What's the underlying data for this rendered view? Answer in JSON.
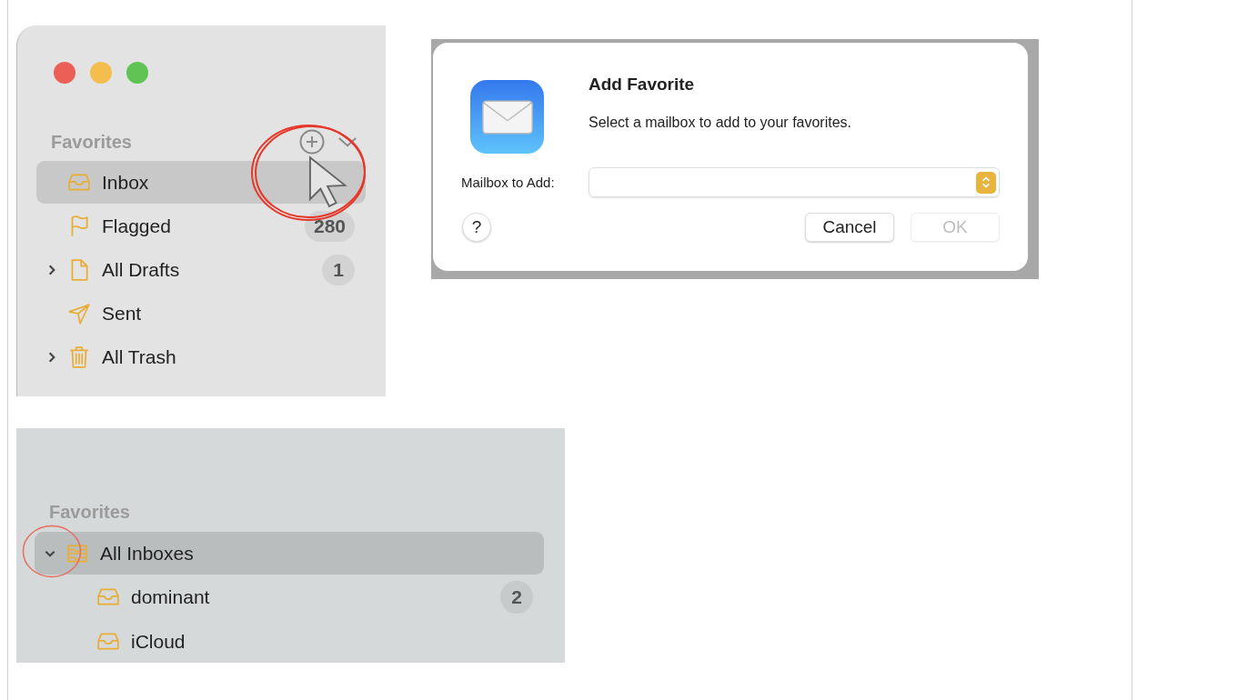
{
  "mail_sidebar": {
    "section_title": "Favorites",
    "items": [
      {
        "label": "Inbox",
        "kind": "inbox",
        "selected": true
      },
      {
        "label": "Flagged",
        "kind": "flag",
        "selected": false,
        "badge": "280"
      },
      {
        "label": "All Drafts",
        "kind": "document",
        "selected": false,
        "expanded": false,
        "badge": "1"
      },
      {
        "label": "Sent",
        "kind": "sent",
        "selected": false
      },
      {
        "label": "All Trash",
        "kind": "trash",
        "selected": false,
        "expanded": false
      }
    ]
  },
  "add_favorite_dialog": {
    "title": "Add Favorite",
    "message": "Select a mailbox to add to your favorites.",
    "field_label": "Mailbox to Add:",
    "help": "?",
    "buttons": [
      {
        "label": "Cancel",
        "disabled": false
      },
      {
        "label": "OK",
        "disabled": true
      }
    ]
  },
  "inboxes_sidebar": {
    "section_title": "Favorites",
    "items": [
      {
        "label": "All Inboxes",
        "kind": "inboxes",
        "selected": true,
        "expanded": true,
        "children": [
          {
            "label": "dominant",
            "kind": "inbox",
            "selected": false,
            "badge": "2"
          },
          {
            "label": "iCloud",
            "kind": "inbox",
            "selected": false
          }
        ]
      }
    ]
  }
}
